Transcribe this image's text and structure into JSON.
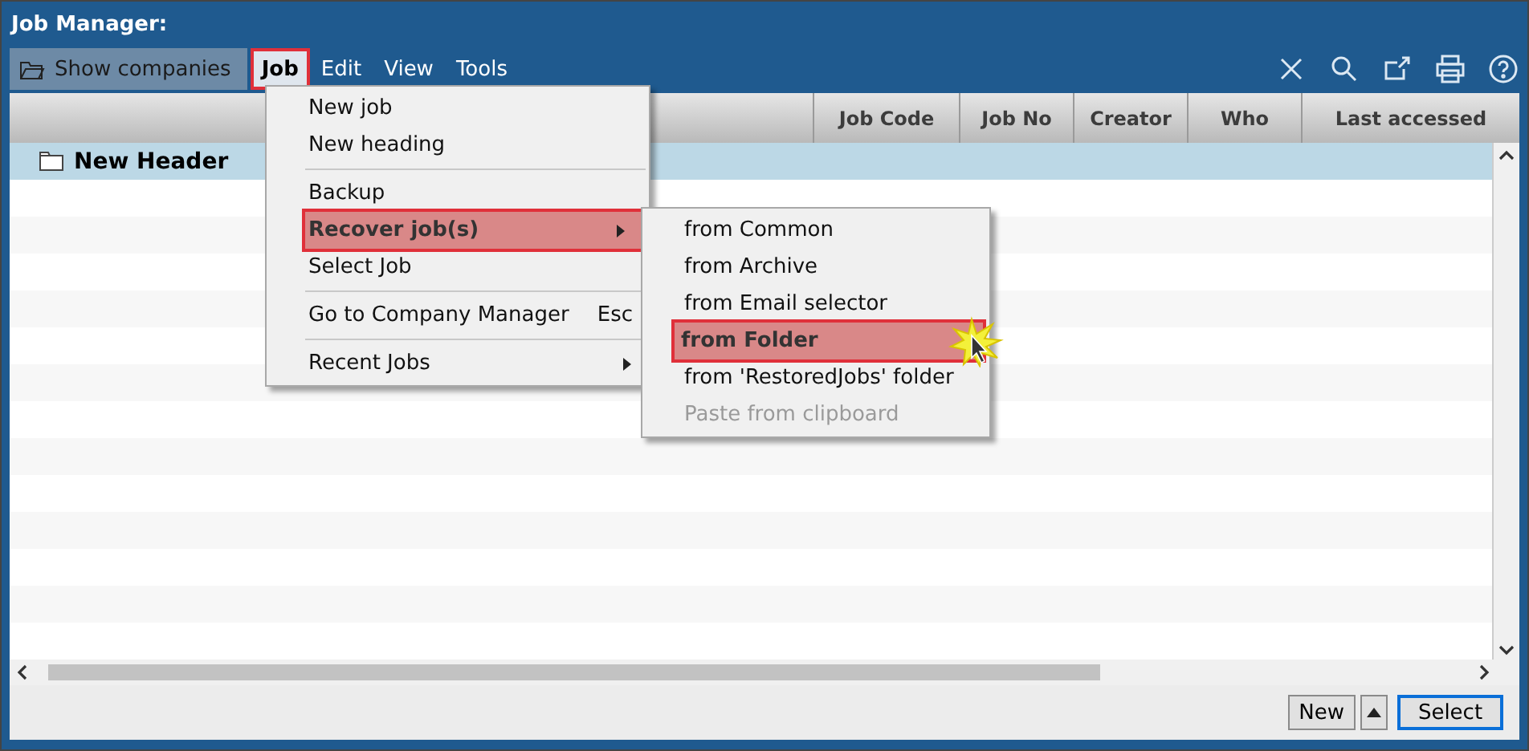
{
  "window": {
    "title": "Job Manager:"
  },
  "toolbar": {
    "show_companies": "Show companies"
  },
  "menubar": [
    {
      "label": "Job",
      "selected": true
    },
    {
      "label": "Edit",
      "selected": false
    },
    {
      "label": "View",
      "selected": false
    },
    {
      "label": "Tools",
      "selected": false
    }
  ],
  "table": {
    "columns": [
      "Job Code",
      "Job No",
      "Creator",
      "Who",
      "Last accessed"
    ],
    "rows": [
      {
        "label": "New Header",
        "selected": true
      }
    ]
  },
  "job_menu": [
    {
      "kind": "item",
      "label": "New job",
      "selected": false,
      "submenu": false
    },
    {
      "kind": "item",
      "label": "New heading",
      "selected": false,
      "submenu": false
    },
    {
      "kind": "separator"
    },
    {
      "kind": "item",
      "label": "Backup",
      "selected": false,
      "submenu": false
    },
    {
      "kind": "item",
      "label": "Recover job(s)",
      "selected": true,
      "submenu": true
    },
    {
      "kind": "item",
      "label": "Select Job",
      "selected": false,
      "submenu": false
    },
    {
      "kind": "separator"
    },
    {
      "kind": "item",
      "label": "Go to Company Manager",
      "shortcut": "Esc",
      "selected": false,
      "submenu": false
    },
    {
      "kind": "separator"
    },
    {
      "kind": "item",
      "label": "Recent Jobs",
      "selected": false,
      "submenu": true
    }
  ],
  "recover_submenu": [
    {
      "label": "from Common",
      "selected": false,
      "disabled": false
    },
    {
      "label": "from Archive",
      "selected": false,
      "disabled": false
    },
    {
      "label": "from Email selector",
      "selected": false,
      "disabled": false
    },
    {
      "label": "from Folder",
      "selected": true,
      "disabled": false
    },
    {
      "label": "from 'RestoredJobs' folder",
      "selected": false,
      "disabled": false
    },
    {
      "label": "Paste from clipboard",
      "selected": false,
      "disabled": true
    }
  ],
  "buttons": {
    "new": "New",
    "select": "Select"
  }
}
